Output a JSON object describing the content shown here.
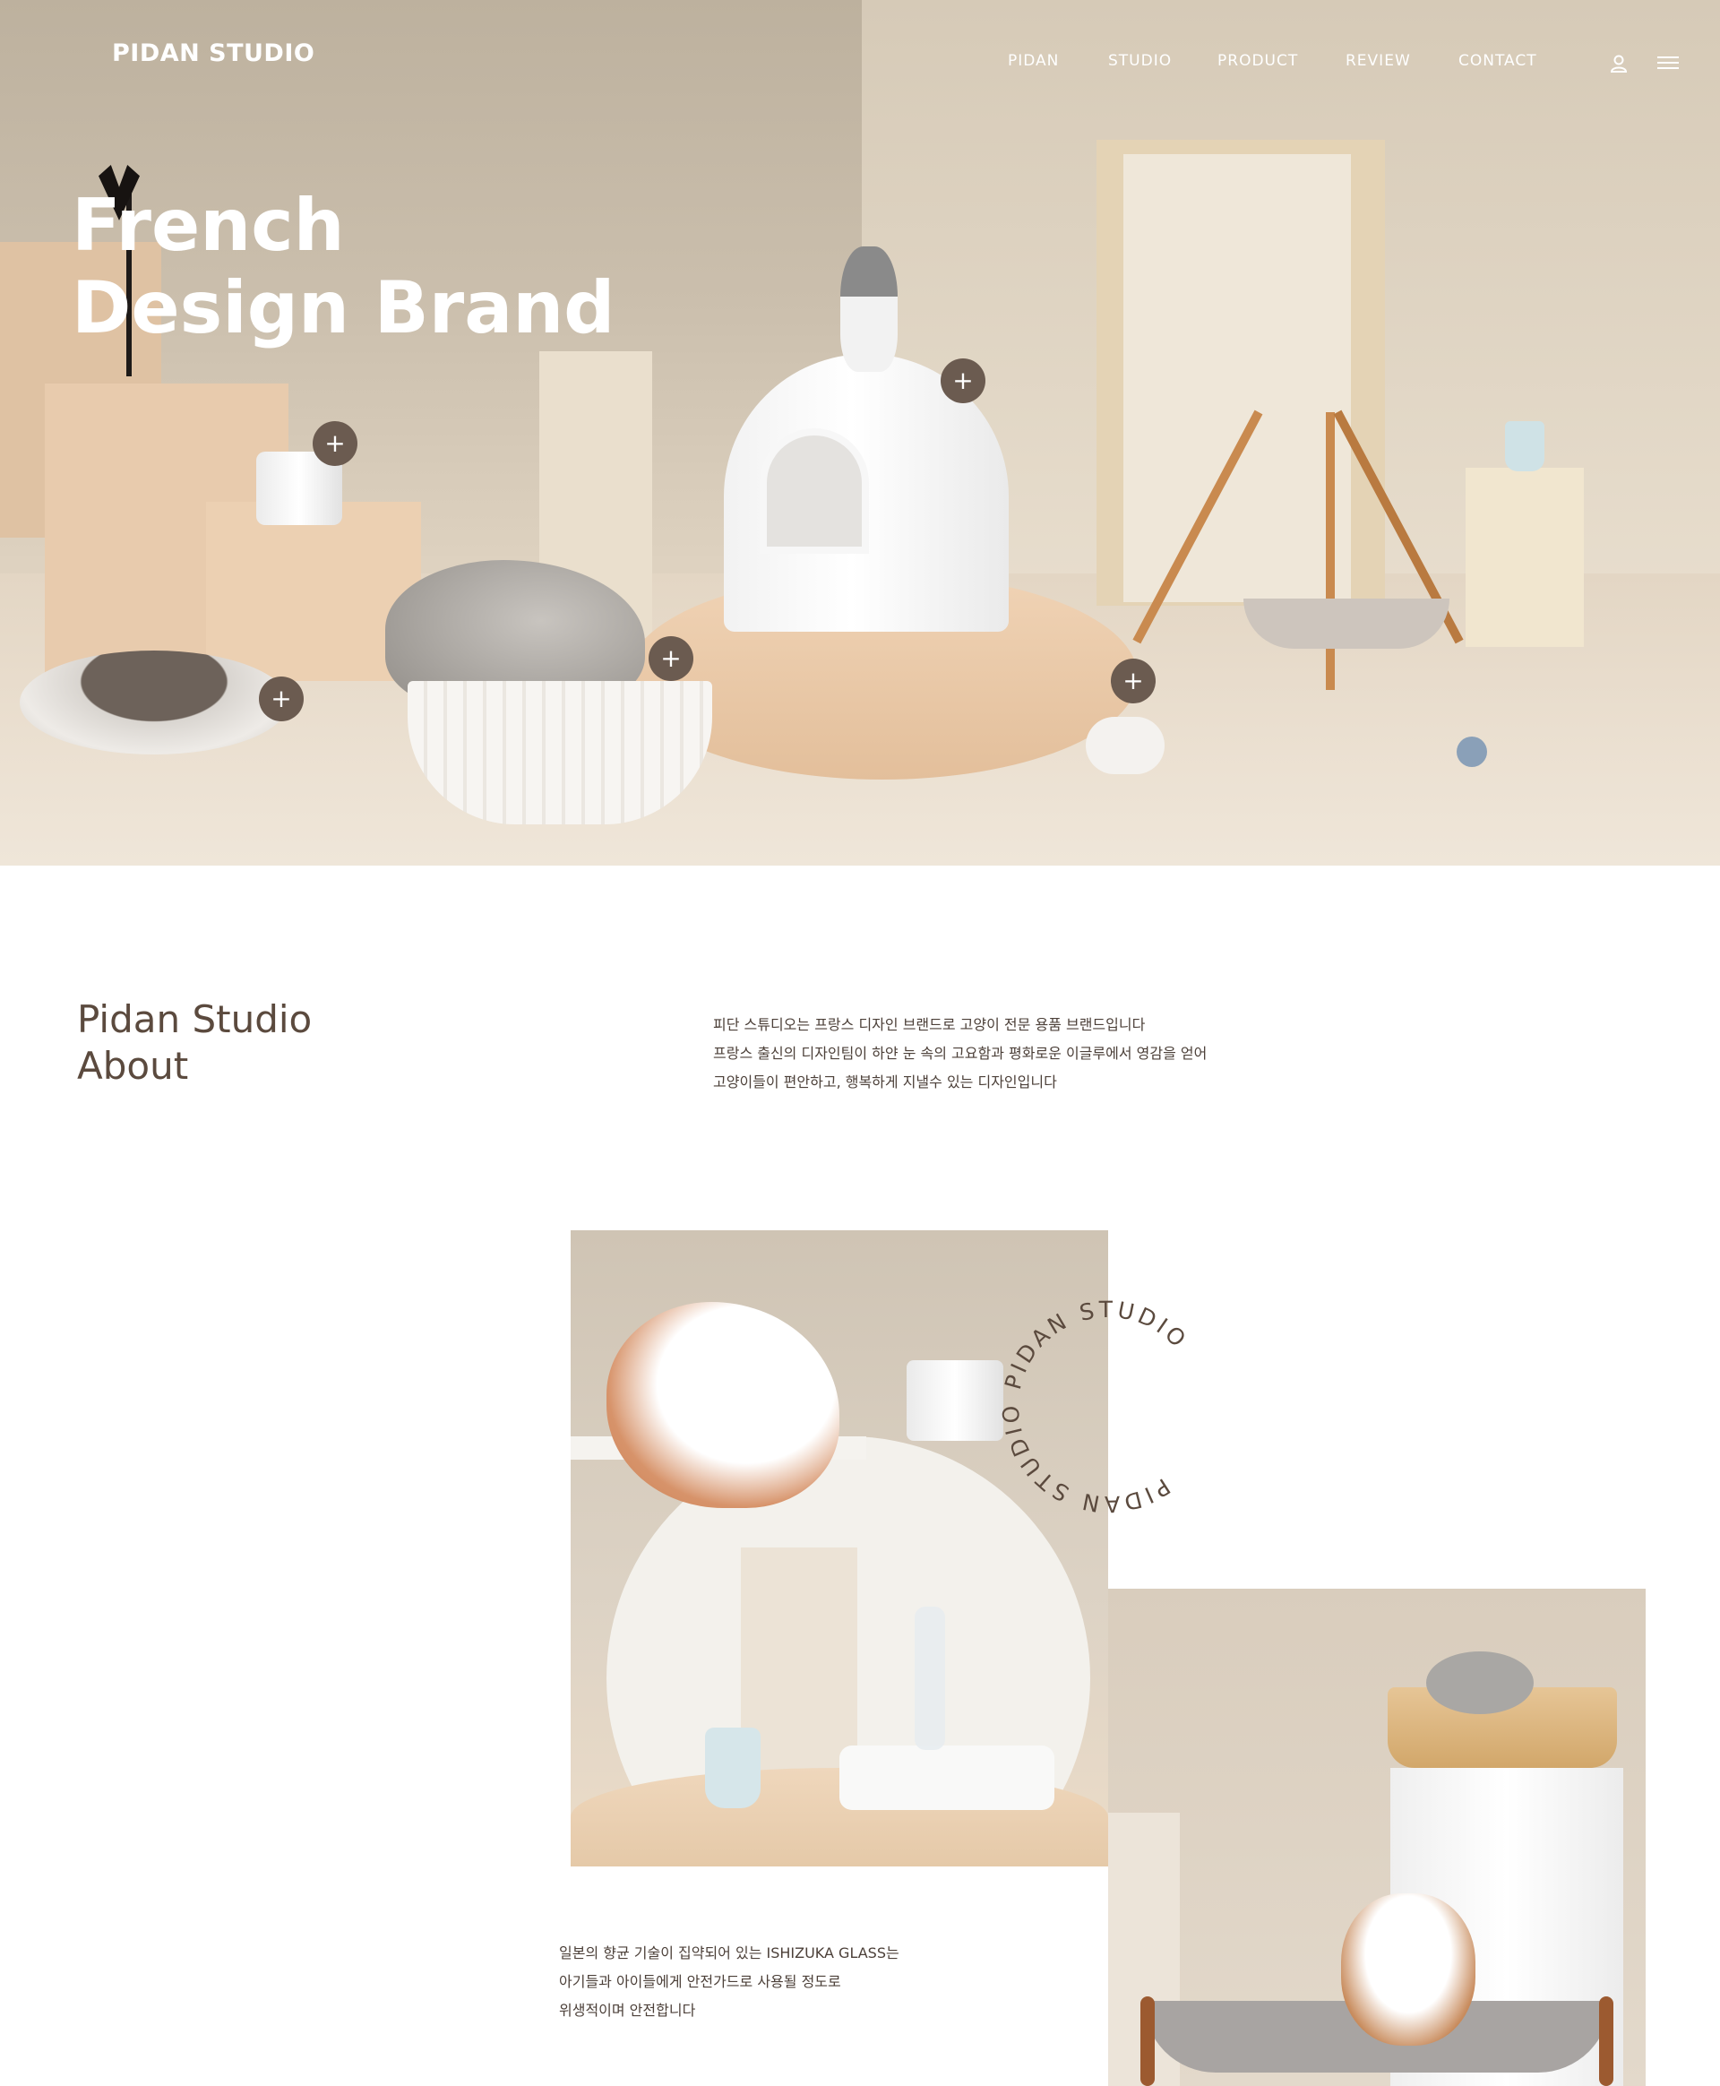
{
  "header": {
    "logo": "PIDAN STUDIO",
    "nav": [
      {
        "label": "PIDAN"
      },
      {
        "label": "STUDIO"
      },
      {
        "label": "PRODUCT"
      },
      {
        "label": "REVIEW"
      },
      {
        "label": "CONTACT"
      }
    ],
    "icons": [
      "user-icon",
      "menu-icon"
    ]
  },
  "hero": {
    "title_line1": "French",
    "title_line2": "Design Brand",
    "hotspot_symbol": "+"
  },
  "about": {
    "heading_line1": "Pidan Studio",
    "heading_line2": "About",
    "body_line1": "피단 스튜디오는 프랑스 디자인 브랜드로 고양이 전문 용품 브랜드입니다",
    "body_line2": "프랑스 출신의 디자인팀이 하얀 눈 속의 고요함과 평화로운 이글루에서 영감을 얻어",
    "body_line3": "고양이들이 편안하고, 행복하게 지낼수 있는 디자인입니다"
  },
  "gallery": {
    "circle_text": "PIDAN STUDIO PIDAN STUDIO ",
    "caption_line1": "일본의 향균 기술이 집약되어 있는 ISHIZUKA GLASS는",
    "caption_line2": "아기들과 아이들에게 안전가드로 사용될 정도로",
    "caption_line3": "위생적이며 안전합니다"
  },
  "colors": {
    "accent": "#6b5b50",
    "heading_text": "#5b4a3e",
    "body_text": "#4c4039",
    "hero_text": "#ffffff"
  }
}
